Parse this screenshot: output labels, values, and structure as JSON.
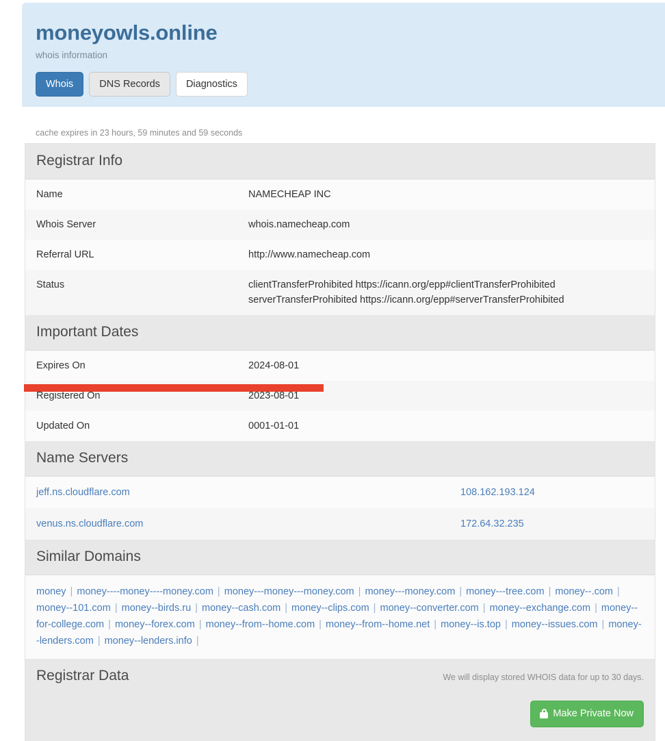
{
  "header": {
    "domain": "moneyowls.online",
    "subtitle": "whois information",
    "tabs": [
      {
        "label": "Whois",
        "state": "active"
      },
      {
        "label": "DNS Records",
        "state": "inactive"
      },
      {
        "label": "Diagnostics",
        "state": "plain"
      }
    ]
  },
  "cache_note": "cache expires in 23 hours, 59 minutes and 59 seconds",
  "registrar_info": {
    "heading": "Registrar Info",
    "rows": [
      {
        "key": "Name",
        "value": "NAMECHEAP INC"
      },
      {
        "key": "Whois Server",
        "value": "whois.namecheap.com"
      },
      {
        "key": "Referral URL",
        "value": "http://www.namecheap.com"
      },
      {
        "key": "Status",
        "value_line1": "clientTransferProhibited https://icann.org/epp#clientTransferProhibited",
        "value_line2": "serverTransferProhibited https://icann.org/epp#serverTransferProhibited"
      }
    ]
  },
  "important_dates": {
    "heading": "Important Dates",
    "rows": [
      {
        "key": "Expires On",
        "value": "2024-08-01"
      },
      {
        "key": "Registered On",
        "value": "2023-08-01"
      },
      {
        "key": "Updated On",
        "value": "0001-01-01"
      }
    ]
  },
  "name_servers": {
    "heading": "Name Servers",
    "rows": [
      {
        "host": "jeff.ns.cloudflare.com",
        "ip": "108.162.193.124"
      },
      {
        "host": "venus.ns.cloudflare.com",
        "ip": "172.64.32.235"
      }
    ]
  },
  "similar_domains": {
    "heading": "Similar Domains",
    "items": [
      "money",
      "money----money----money.com",
      "money---money---money.com",
      "money---money.com",
      "money---tree.com",
      "money--.com",
      "money--101.com",
      "money--birds.ru",
      "money--cash.com",
      "money--clips.com",
      "money--converter.com",
      "money--exchange.com",
      "money--for-college.com",
      "money--forex.com",
      "money--from--home.com",
      "money--from--home.net",
      "money--is.top",
      "money--issues.com",
      "money--lenders.com",
      "money--lenders.info"
    ],
    "separator": "|"
  },
  "registrar_data": {
    "heading": "Registrar Data",
    "note": "We will display stored WHOIS data for up to 30 days.",
    "button_label": "Make Private Now",
    "button_icon": "lock-icon"
  },
  "annotation": {
    "type": "red-highlight-bar",
    "color": "#e8412c",
    "targets_row": "Registered On"
  },
  "colors": {
    "header_bg": "#dbeaf7",
    "title": "#3b6e99",
    "active_tab": "#3c7bb5",
    "link": "#4a7ebb",
    "section_head_bg": "#e8e8e8",
    "button_green": "#5cb85c",
    "annotation_red": "#e8412c"
  }
}
